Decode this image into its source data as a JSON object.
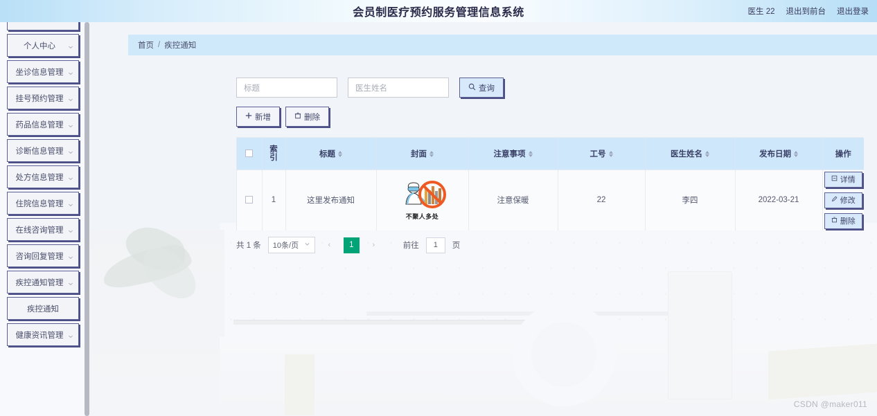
{
  "header": {
    "title": "会员制医疗预约服务管理信息系统",
    "user_label": "医生 22",
    "exit_front_label": "退出到前台",
    "logout_label": "退出登录"
  },
  "sidebar": {
    "items": [
      {
        "label": "",
        "expandable": true
      },
      {
        "label": "个人中心",
        "expandable": true
      },
      {
        "label": "坐诊信息管理",
        "expandable": true
      },
      {
        "label": "挂号预约管理",
        "expandable": true
      },
      {
        "label": "药品信息管理",
        "expandable": true
      },
      {
        "label": "诊断信息管理",
        "expandable": true
      },
      {
        "label": "处方信息管理",
        "expandable": true
      },
      {
        "label": "住院信息管理",
        "expandable": true
      },
      {
        "label": "在线咨询管理",
        "expandable": true
      },
      {
        "label": "咨询回复管理",
        "expandable": true
      },
      {
        "label": "疾控通知管理",
        "expandable": true
      },
      {
        "label": "疾控通知",
        "expandable": false
      },
      {
        "label": "健康资讯管理",
        "expandable": true
      }
    ]
  },
  "breadcrumb": {
    "home": "首页",
    "separator": "/",
    "current": "疾控通知"
  },
  "filters": {
    "title_placeholder": "标题",
    "doctor_placeholder": "医生姓名",
    "title_value": "",
    "doctor_value": "",
    "search_label": "查询"
  },
  "toolbar": {
    "add_label": "新增",
    "delete_label": "删除"
  },
  "table": {
    "columns": [
      {
        "label": "",
        "sortable": false
      },
      {
        "label": "索引",
        "sortable": false
      },
      {
        "label": "标题",
        "sortable": true
      },
      {
        "label": "封面",
        "sortable": true
      },
      {
        "label": "注意事项",
        "sortable": true
      },
      {
        "label": "工号",
        "sortable": true
      },
      {
        "label": "医生姓名",
        "sortable": true
      },
      {
        "label": "发布日期",
        "sortable": true
      },
      {
        "label": "操作",
        "sortable": false
      }
    ],
    "rows": [
      {
        "index": "1",
        "title": "这里发布通知",
        "cover_caption": "不聚人多处",
        "notice": "注意保暖",
        "job_no": "22",
        "doctor": "李四",
        "publish_date": "2022-03-21",
        "ops": {
          "detail": "详情",
          "edit": "修改",
          "delete": "删除"
        }
      }
    ]
  },
  "pagination": {
    "total_text": "共 1 条",
    "page_size": "10条/页",
    "prev": "‹",
    "next": "›",
    "current_page": "1",
    "goto_label": "前往",
    "goto_value": "1",
    "page_unit": "页"
  },
  "watermark": "CSDN @maker011",
  "colors": {
    "header_blue": "#cfe9fa",
    "accent_purple": "#5b5f93",
    "pager_green": "#00a477",
    "table_head": "#cfe7fa"
  }
}
